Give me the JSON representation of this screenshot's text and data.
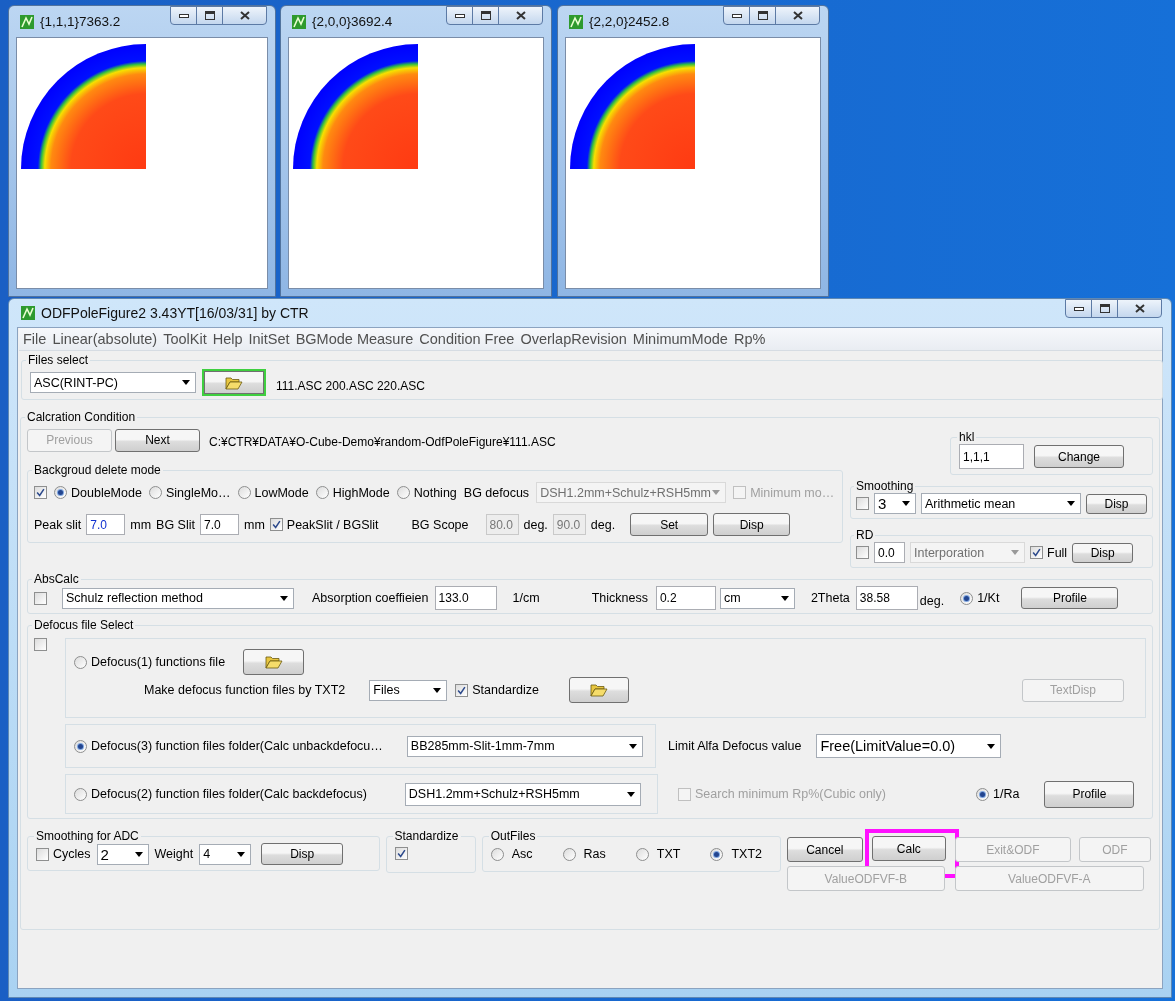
{
  "pole_windows": [
    {
      "title": "{1,1,1}7363.2"
    },
    {
      "title": "{2,0,0}3692.4"
    },
    {
      "title": "{2,2,0}2452.8"
    }
  ],
  "window": {
    "title": "ODFPoleFigure2 3.43YT[16/03/31] by CTR"
  },
  "menu": [
    "File",
    "Linear(absolute)",
    "ToolKit",
    "Help",
    "InitSet",
    "BGMode Measure",
    "Condition Free",
    "OverlapRevision",
    "MinimumMode",
    "Rp%"
  ],
  "files_select": {
    "legend": "Files select",
    "format": "ASC(RINT-PC)",
    "files": "111.ASC 200.ASC 220.ASC"
  },
  "calc_condition": {
    "legend": "Calcration Condition",
    "nav_buttons": [
      {
        "label": "Previous",
        "disabled": true
      },
      {
        "label": "Next",
        "disabled": false
      }
    ],
    "path": "C:¥CTR¥DATA¥O-Cube-Demo¥random-OdfPoleFigure¥111.ASC"
  },
  "hkl": {
    "legend": "hkl",
    "value": "1,1,1",
    "button": "Change"
  },
  "bg_mode": {
    "legend": "Backgroud delete mode",
    "checked": true,
    "modes": [
      {
        "label": "DoubleMode",
        "selected": true
      },
      {
        "label": "SingleMo…",
        "selected": false
      },
      {
        "label": "LowMode",
        "selected": false
      },
      {
        "label": "HighMode",
        "selected": false
      },
      {
        "label": "Nothing",
        "selected": false
      }
    ],
    "bg_defocus_label": "BG defocus",
    "bg_defocus": {
      "value": "DSH1.2mm+Schulz+RSH5mm",
      "disabled": true
    },
    "minimum": {
      "label": "Minimum mo…",
      "checked": false,
      "disabled": true
    },
    "peak_slit_label": "Peak slit",
    "peak_slit": "7.0",
    "peak_unit": "mm",
    "bg_slit_label": "BG Slit",
    "bg_slit": "7.0",
    "bg_unit": "mm",
    "ratio": {
      "label": "PeakSlit / BGSlit",
      "checked": true
    },
    "scope_label": "BG Scope",
    "scope_from": "80.0",
    "scope_from_unit": "deg.",
    "scope_to": "90.0",
    "scope_to_unit": "deg.",
    "set": "Set",
    "disp": "Disp"
  },
  "smoothing": {
    "legend": "Smoothing",
    "checked": false,
    "count": "3",
    "method": "Arithmetic mean",
    "disp": "Disp"
  },
  "rd": {
    "legend": "RD",
    "checked": false,
    "value": "0.0",
    "method": {
      "value": "Interporation",
      "disabled": true
    },
    "full": {
      "label": "Full",
      "checked": true
    },
    "disp": "Disp"
  },
  "abs_calc": {
    "legend": "AbsCalc",
    "checked": false,
    "method": "Schulz reflection method",
    "coef_label": "Absorption coeffieien",
    "coef": "133.0",
    "coef_unit": "1/cm",
    "thickness_label": "Thickness",
    "thickness": "0.2",
    "thickness_unit": "cm",
    "theta_label": "2Theta",
    "theta": "38.58",
    "theta_unit": "deg.",
    "kt": {
      "label": "1/Kt",
      "selected": true
    },
    "profile": "Profile"
  },
  "defocus": {
    "legend": "Defocus file Select",
    "checked": false,
    "option1": {
      "label": "Defocus(1) functions file",
      "selected": false,
      "make_label": "Make defocus function files by TXT2",
      "make_type": "Files",
      "standardize": {
        "label": "Standardize",
        "checked": true
      },
      "text_disp": {
        "label": "TextDisp",
        "disabled": true
      }
    },
    "option3": {
      "label": "Defocus(3) function files folder(Calc unbackdefocu…",
      "selected": true,
      "folder": "BB285mm-Slit-1mm-7mm",
      "limit_label": "Limit Alfa Defocus value",
      "limit": "Free(LimitValue=0.0)"
    },
    "option2": {
      "label": "Defocus(2) function files folder(Calc backdefocus)",
      "selected": false,
      "folder": "DSH1.2mm+Schulz+RSH5mm",
      "search": {
        "label": "Search minimum Rp%(Cubic only)",
        "checked": false,
        "disabled": true
      },
      "ra": {
        "label": "1/Ra",
        "selected": true
      },
      "profile": "Profile"
    }
  },
  "adc": {
    "legend": "Smoothing for ADC",
    "cycles": {
      "label": "Cycles",
      "checked": false
    },
    "cycles_value": "2",
    "weight_label": "Weight",
    "weight": "4",
    "disp": "Disp"
  },
  "standardize": {
    "legend": "Standardize",
    "checked": true
  },
  "out_files": {
    "legend": "OutFiles",
    "options": [
      {
        "label": "Asc",
        "selected": false
      },
      {
        "label": "Ras",
        "selected": false
      },
      {
        "label": "TXT",
        "selected": false
      },
      {
        "label": "TXT2",
        "selected": true
      }
    ]
  },
  "buttons": [
    {
      "label": "Cancel",
      "disabled": false,
      "highlighted": false
    },
    {
      "label": "Calc",
      "disabled": false,
      "highlighted": true
    },
    {
      "label": "Exit&ODF",
      "disabled": true,
      "highlighted": false
    },
    {
      "label": "ODF",
      "disabled": true,
      "highlighted": false
    },
    {
      "label": "ValueODFVF-B",
      "disabled": true,
      "highlighted": false
    },
    {
      "label": "ValueODFVF-A",
      "disabled": true,
      "highlighted": false
    }
  ]
}
